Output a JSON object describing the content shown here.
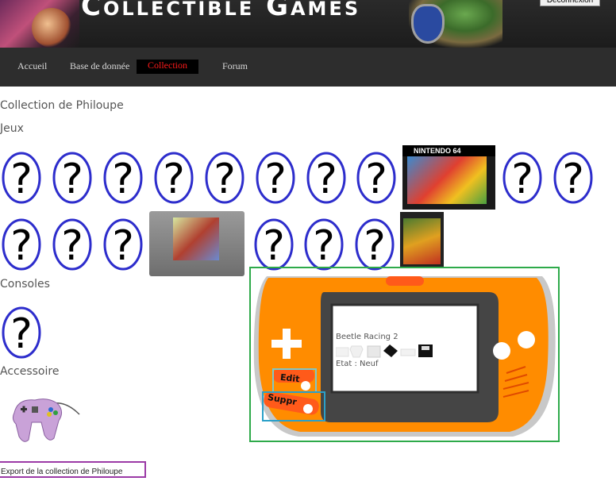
{
  "header": {
    "site_title": "Collectible Games",
    "logout_label": "Déconnexion"
  },
  "nav": {
    "items": [
      {
        "label": "Accueil"
      },
      {
        "label": "Base de donnée"
      },
      {
        "label": "Collection"
      },
      {
        "label": "Forum"
      }
    ],
    "active": "Collection"
  },
  "page": {
    "title": "Collection de Philoupe",
    "sections": {
      "games": "Jeux",
      "consoles": "Consoles",
      "accessories": "Accessoire"
    },
    "export_label": "Export de la collection de Philoupe"
  },
  "games_row1": [
    "unknown",
    "unknown",
    "unknown",
    "unknown",
    "unknown",
    "unknown",
    "unknown",
    "unknown",
    "Mario Kart 64 box",
    "unknown",
    "unknown"
  ],
  "games_row2": [
    "unknown",
    "unknown",
    "unknown",
    "Mario Kart 64 cartridge",
    "unknown",
    "unknown",
    "unknown",
    "Mario Kart box"
  ],
  "box_cover_text": "NINTENDO 64",
  "popup": {
    "game_name": "Beetle Racing 2",
    "state": "Etat : Neuf",
    "edit_label": "Edit",
    "delete_label": "Suppr"
  },
  "colors": {
    "nav_active": "#ff1a1a",
    "gba_orange": "#ff8c00",
    "frame_green": "#2eaa4a"
  }
}
